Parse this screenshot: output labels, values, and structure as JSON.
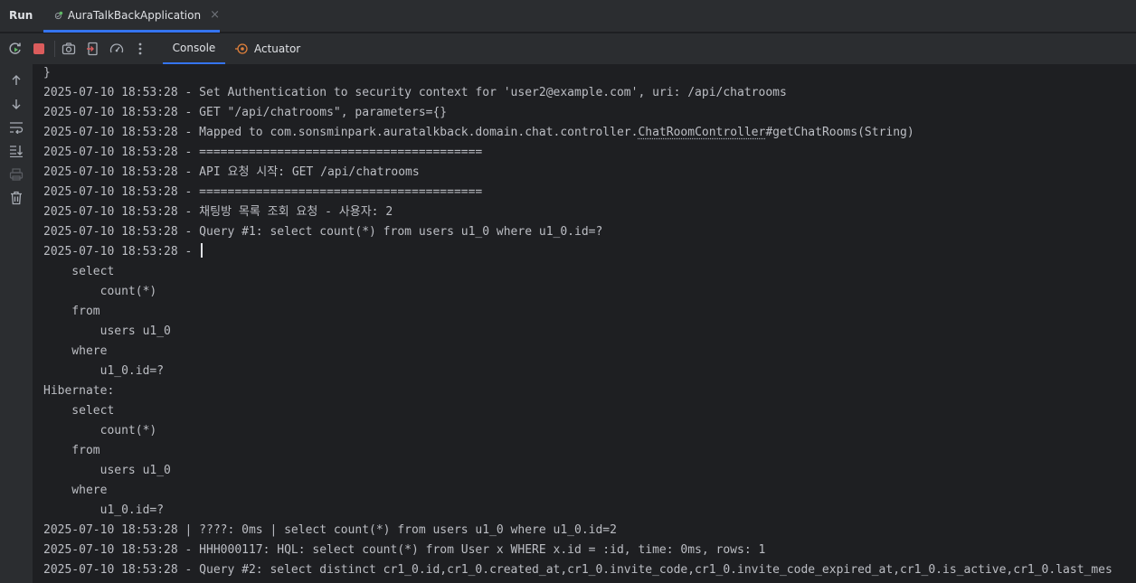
{
  "titlebar": {
    "run_label": "Run",
    "tab_label": "AuraTalkBackApplication",
    "tab_close": "×"
  },
  "toolbar": {
    "tabs": [
      {
        "label": "Console",
        "active": true
      },
      {
        "label": "Actuator",
        "active": false
      }
    ],
    "buttons": [
      "rerun-icon",
      "stop-icon",
      "screenshot-icon",
      "exit-icon",
      "dashboard-icon",
      "more-icon"
    ]
  },
  "gutter": {
    "buttons": [
      "arrow-up-icon",
      "arrow-down-icon",
      "soft-wrap-icon",
      "scroll-to-end-icon",
      "print-icon",
      "trash-icon"
    ]
  },
  "colors": {
    "accent": "#3574f0",
    "stop": "#db5c5c",
    "rerun": "#5fb865",
    "background": "#1e1f22",
    "panel": "#2b2d30",
    "text": "#bcbec4"
  },
  "console": {
    "lines": [
      "}",
      "2025-07-10 18:53:28 - Set Authentication to security context for 'user2@example.com', uri: /api/chatrooms",
      "2025-07-10 18:53:28 - GET \"/api/chatrooms\", parameters={}",
      {
        "pre": "2025-07-10 18:53:28 - Mapped to com.sonsminpark.auratalkback.domain.chat.controller.",
        "link": "ChatRoomController",
        "post": "#getChatRooms(String)"
      },
      "2025-07-10 18:53:28 - ========================================",
      "2025-07-10 18:53:28 - API 요청 시작: GET /api/chatrooms",
      "2025-07-10 18:53:28 - ========================================",
      "2025-07-10 18:53:28 - 채팅방 목록 조회 요청 - 사용자: 2",
      "2025-07-10 18:53:28 - Query #1: select count(*) from users u1_0 where u1_0.id=?",
      {
        "pre": "2025-07-10 18:53:28 - ",
        "caret": true
      },
      "    select",
      "        count(*)",
      "    from",
      "        users u1_0",
      "    where",
      "        u1_0.id=?",
      "Hibernate: ",
      "    select",
      "        count(*)",
      "    from",
      "        users u1_0",
      "    where",
      "        u1_0.id=?",
      "2025-07-10 18:53:28 | ????: 0ms | select count(*) from users u1_0 where u1_0.id=2",
      "2025-07-10 18:53:28 - HHH000117: HQL: select count(*) from User x WHERE x.id = :id, time: 0ms, rows: 1",
      "2025-07-10 18:53:28 - Query #2: select distinct cr1_0.id,cr1_0.created_at,cr1_0.invite_code,cr1_0.invite_code_expired_at,cr1_0.is_active,cr1_0.last_mes"
    ]
  }
}
